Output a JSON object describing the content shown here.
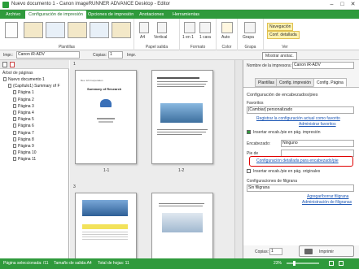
{
  "window": {
    "title": "Nuevo documento 1 - Canon imageRUNNER ADVANCE Desktop - Editor"
  },
  "menu": {
    "tabs": [
      "Archivo",
      "Configuración de impresión",
      "Opciones de impresión",
      "Anotaciones",
      "Herramientas"
    ]
  },
  "ribbon": {
    "groups": {
      "plantillas": "Plantillas",
      "papel": "Papel salida",
      "formato": "Formato",
      "color": "Color",
      "grapa": "Grapa",
      "ver": "Ver"
    },
    "orientation": "Vertical",
    "size": "A4",
    "layout": "1 en 1",
    "duplex": "1 cara",
    "color_mode": "Auto",
    "staple": "Grapa",
    "view_nav": "Navegación",
    "view_conf": "Conf. detallada"
  },
  "toolbar": {
    "printer_label": "Impr.:",
    "printer_value": "Canon iR-ADV",
    "copies_label": "Copias:",
    "copies_value": "1",
    "print_label": "Impr.",
    "annotations_button": "Mostrar anotac."
  },
  "leftpane": {
    "tree_root_label": "Árbol de páginas",
    "items": [
      "Nuevo documento 1",
      "(Capítulo1) Summary of F",
      "Página 1",
      "Página 2",
      "Página 3",
      "Página 4",
      "Página 5",
      "Página 6",
      "Página 7",
      "Página 8",
      "Página 9",
      "Página 10",
      "Página 11"
    ]
  },
  "document": {
    "sections": [
      "1",
      "3"
    ],
    "pages": [
      {
        "label": "1-1",
        "title": "Summary of Research"
      },
      {
        "label": "1-2",
        "title": ""
      }
    ]
  },
  "rightpane": {
    "printer_name_label": "Nombre de la impresora:",
    "printer_name_value": "Canon iR-ADV",
    "tabs": [
      "Plantillas",
      "Config. impresión",
      "Config. Página"
    ],
    "section_title": "Configuración de encabezados/pies",
    "favorites_label": "Favoritos",
    "favorites_value": "[Cambiar] personalizado",
    "register_link": "Registrar la configuración actual como favorito",
    "admin_fav_link": "Administrar favoritos",
    "header_check": "Insertar encab./pie en pág. impresión",
    "header_label": "Encabezado:",
    "header_value": "Ninguno",
    "footer_label": "Pie de",
    "detail_link": "Configuración detallada para encabezado/pie",
    "insert_original": "Insertar encab./pie en pág. originales",
    "watermark_title": "Configuraciones de filigrana",
    "watermark_value": "Sin filigrana",
    "add_watermark_link": "Agregar/borrar filigrana",
    "admin_watermark_link": "Administración de filigranas",
    "copies_label": "Copias:",
    "copies_value": "1",
    "print_button": "Imprimir"
  },
  "status": {
    "selected_page": "Página seleccionada: /11",
    "output_size": "Tamaño de salida:A4",
    "total_pages": "Total de hojas: 11",
    "zoom": "23%"
  },
  "colors": {
    "accent": "#2f9a3c",
    "highlight": "#e00000",
    "link": "#1a55b4"
  }
}
